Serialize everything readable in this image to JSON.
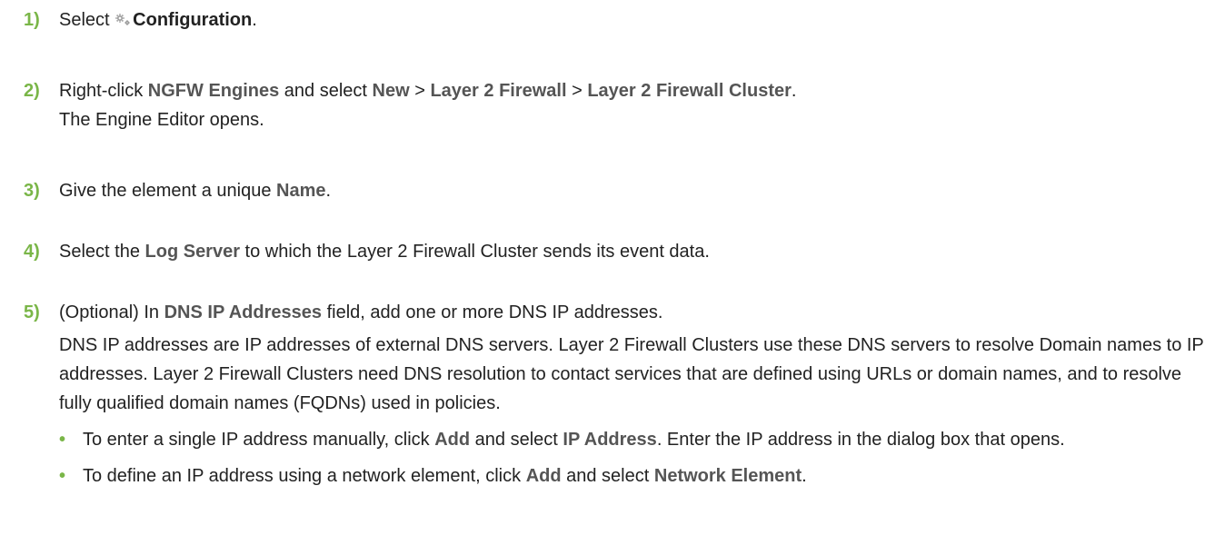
{
  "steps": [
    {
      "num": "1)",
      "line1": {
        "pre": "Select ",
        "ui": "Configuration",
        "post": "."
      }
    },
    {
      "num": "2)",
      "line1": {
        "t1": "Right-click ",
        "ui1": "NGFW Engines",
        "t2": " and select ",
        "ui2": "New",
        "t3": " > ",
        "ui3": "Layer 2 Firewall",
        "t4": " > ",
        "ui4": "Layer 2 Firewall Cluster",
        "t5": "."
      },
      "line2": "The Engine Editor opens."
    },
    {
      "num": "3)",
      "line1": {
        "pre": "Give the element a unique ",
        "ui": "Name",
        "post": "."
      }
    },
    {
      "num": "4)",
      "line1": {
        "pre": "Select the ",
        "ui": "Log Server",
        "post": " to which the Layer 2 Firewall Cluster sends its event data."
      }
    },
    {
      "num": "5)",
      "line1": {
        "pre": "(Optional) In ",
        "ui": "DNS IP Addresses",
        "post": " field, add one or more DNS IP addresses."
      },
      "para": "DNS IP addresses are IP addresses of external DNS servers. Layer 2 Firewall Clusters use these DNS servers to resolve Domain names to IP addresses. Layer 2 Firewall Clusters need DNS resolution to contact services that are defined using URLs or domain names, and to resolve fully qualified domain names (FQDNs) used in policies.",
      "bullets": [
        {
          "t1": "To enter a single IP address manually, click ",
          "ui1": "Add",
          "t2": " and select ",
          "ui2": "IP Address",
          "t3": ". Enter the IP address in the dialog box that opens."
        },
        {
          "t1": "To define an IP address using a network element, click ",
          "ui1": "Add",
          "t2": " and select ",
          "ui2": "Network Element",
          "t3": "."
        }
      ]
    }
  ],
  "icons": {
    "configuration": "gear-icon",
    "bullet": "bullet-dot"
  },
  "colors": {
    "step_number": "#7ab648",
    "ui_term": "#555555",
    "text": "#222222"
  }
}
